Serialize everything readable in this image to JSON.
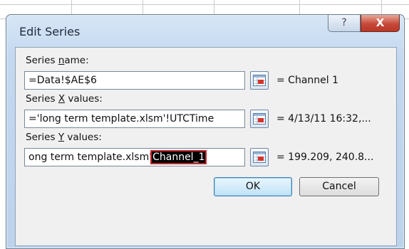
{
  "dialog": {
    "title": "Edit Series",
    "help_label": "?",
    "close_label": "X"
  },
  "series_name": {
    "label_pre": "Series ",
    "label_key": "n",
    "label_post": "ame:",
    "value": "=Data!$AE$6",
    "result": "= Channel 1"
  },
  "series_x": {
    "label_pre": "Series ",
    "label_key": "X",
    "label_post": " values:",
    "value": "='long term template.xlsm'!UTCTime",
    "result": "= 4/13/11 16:32,..."
  },
  "series_y": {
    "label_pre": "Series ",
    "label_key": "Y",
    "label_post": " values:",
    "value_prefix": "ong term template.xlsm'",
    "value_selected": "Channel_1",
    "result": "= 199.209, 240.8..."
  },
  "buttons": {
    "ok": "OK",
    "cancel": "Cancel"
  },
  "icons": {
    "range_picker": "collapse-dialog-icon",
    "help": "help-icon",
    "close": "close-icon"
  },
  "colors": {
    "selection_outline": "#c0282e",
    "close_button": "#c6493a"
  }
}
